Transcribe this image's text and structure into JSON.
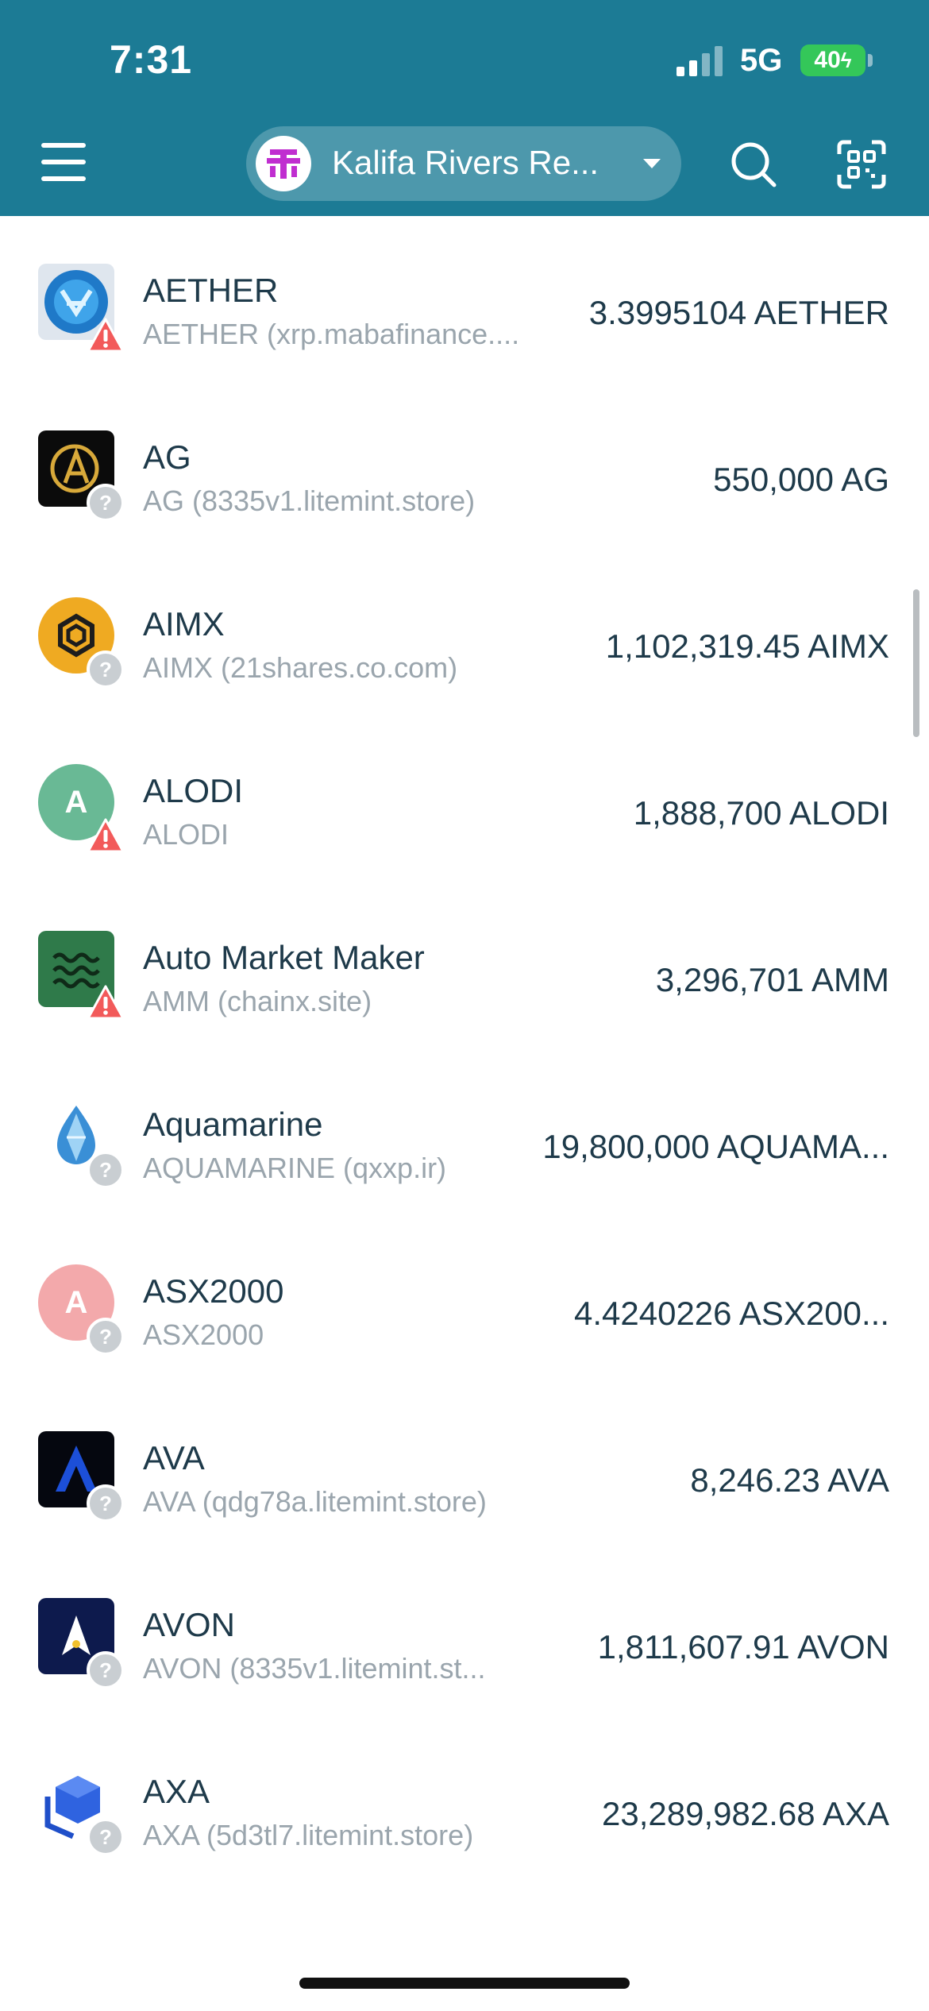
{
  "status_bar": {
    "time": "7:31",
    "network": "5G",
    "battery": "40"
  },
  "header": {
    "account_name": "Kalifa Rivers Re...",
    "icons": {
      "menu": "hamburger-icon",
      "search": "search-icon",
      "scan": "qr-scan-icon",
      "avatar": "account-logo-icon"
    }
  },
  "tokens": [
    {
      "name": "AETHER",
      "sub": "AETHER (xrp.mabafinance....",
      "amount": "3.3995104 AETHER",
      "badge": "warning"
    },
    {
      "name": "AG",
      "sub": "AG (8335v1.litemint.store)",
      "amount": "550,000 AG",
      "badge": "unknown"
    },
    {
      "name": "AIMX",
      "sub": "AIMX (21shares.co.com)",
      "amount": "1,102,319.45 AIMX",
      "badge": "unknown"
    },
    {
      "name": "ALODI",
      "sub": "ALODI",
      "amount": "1,888,700 ALODI",
      "badge": "warning",
      "icon_letter": "A"
    },
    {
      "name": "Auto Market Maker",
      "sub": "AMM (chainx.site)",
      "amount": "3,296,701 AMM",
      "badge": "warning"
    },
    {
      "name": "Aquamarine",
      "sub": "AQUAMARINE (qxxp.ir)",
      "amount": "19,800,000 AQUAMA...",
      "badge": "unknown"
    },
    {
      "name": "ASX2000",
      "sub": "ASX2000",
      "amount": "4.4240226 ASX200...",
      "badge": "unknown",
      "icon_letter": "A"
    },
    {
      "name": "AVA",
      "sub": "AVA (qdg78a.litemint.store)",
      "amount": "8,246.23 AVA",
      "badge": "unknown"
    },
    {
      "name": "AVON",
      "sub": "AVON (8335v1.litemint.st...",
      "amount": "1,811,607.91 AVON",
      "badge": "unknown"
    },
    {
      "name": "AXA",
      "sub": "AXA (5d3tl7.litemint.store)",
      "amount": "23,289,982.68 AXA",
      "badge": "unknown"
    }
  ],
  "colors": {
    "header_bg": "#1c7b95",
    "warning": "#f25a5a",
    "unknown_badge": "#c9ced2",
    "text": "#1e3a4a",
    "subtext": "#9aa5ad"
  }
}
